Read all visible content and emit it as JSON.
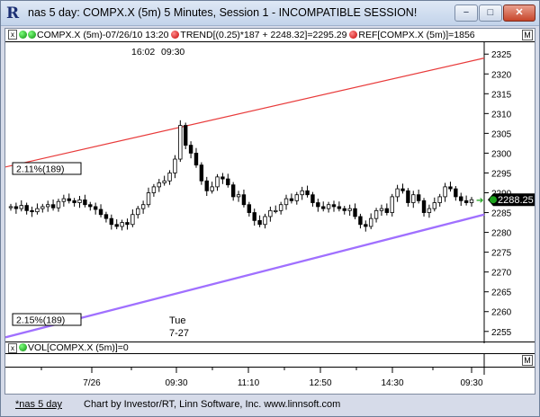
{
  "window": {
    "title": "nas 5 day: COMPX.X (5m) 5 Minutes, Session 1 - INCOMPATIBLE SESSION!",
    "app_icon_glyph": "R",
    "min_glyph": "−",
    "max_glyph": "□",
    "close_glyph": "✕"
  },
  "legend": {
    "x_glyph": "x",
    "price_label": "COMPX.X (5m)-07/26/10 13:20",
    "trend_label": "TREND[(0.25)*187 + 2248.32]=2295.29",
    "ref_label": "REF[COMPX.X (5m)]=1856",
    "m_glyph": "M"
  },
  "chart": {
    "session_times": [
      "16:02",
      "09:30"
    ],
    "pct_upper": "2.11%(189)",
    "pct_lower": "2.15%(189)",
    "day_label": "Tue",
    "date_label": "7-27",
    "current_price": "2288.25",
    "y_ticks": [
      "2325",
      "2320",
      "2315",
      "2310",
      "2305",
      "2300",
      "2295",
      "2290",
      "2285",
      "2280",
      "2275",
      "2270",
      "2265",
      "2260",
      "2255"
    ],
    "colors": {
      "trend_upper": "#e83a3a",
      "trend_lower": "#a070ff",
      "candle": "#000000",
      "price_badge": "#000000"
    }
  },
  "chart_data": {
    "type": "candlestick",
    "ylim": [
      2252,
      2328
    ],
    "y_ticks": [
      2325,
      2320,
      2315,
      2310,
      2305,
      2300,
      2295,
      2290,
      2285,
      2280,
      2275,
      2270,
      2265,
      2260,
      2255
    ],
    "x_tick_labels": [
      "7/26",
      "09:30",
      "11:10",
      "12:50",
      "14:30",
      "09:30"
    ],
    "last_price": 2288.25,
    "trend_upper": {
      "start": 2296.5,
      "end": 2324.0
    },
    "trend_lower": {
      "start": 2253.5,
      "end": 2284.5
    },
    "closes": [
      2286.5,
      2286.0,
      2286.8,
      2285.5,
      2285.2,
      2286.0,
      2286.5,
      2287.0,
      2286.2,
      2287.8,
      2288.5,
      2288.0,
      2287.5,
      2288.2,
      2287.0,
      2286.5,
      2285.8,
      2284.5,
      2283.5,
      2282.0,
      2281.5,
      2282.5,
      2282.0,
      2284.5,
      2286.0,
      2287.0,
      2290.0,
      2291.5,
      2292.5,
      2293.0,
      2295.0,
      2298.5,
      2307.0,
      2302.0,
      2300.0,
      2297.0,
      2293.0,
      2290.5,
      2291.5,
      2294.0,
      2293.5,
      2292.0,
      2289.0,
      2289.5,
      2287.0,
      2285.0,
      2283.0,
      2282.0,
      2284.0,
      2285.5,
      2285.5,
      2287.0,
      2288.5,
      2288.0,
      2289.5,
      2290.5,
      2289.5,
      2287.5,
      2286.5,
      2286.0,
      2287.0,
      2286.5,
      2286.0,
      2285.5,
      2286.0,
      2284.0,
      2282.0,
      2281.5,
      2283.5,
      2285.5,
      2286.0,
      2285.0,
      2289.0,
      2291.0,
      2290.5,
      2287.5,
      2289.5,
      2288.0,
      2285.0,
      2286.0,
      2287.5,
      2289.0,
      2291.5,
      2291.0,
      2289.0,
      2288.0,
      2287.5,
      2288.25
    ]
  },
  "volume": {
    "label": "VOL[COMPX.X (5m)]=0"
  },
  "time_axis": {
    "labels": [
      "7/26",
      "09:30",
      "11:10",
      "12:50",
      "14:30",
      "09:30"
    ]
  },
  "status": {
    "tab_label": "*nas 5 day",
    "credit": "Chart by Investor/RT, Linn Software, Inc. www.linnsoft.com"
  }
}
